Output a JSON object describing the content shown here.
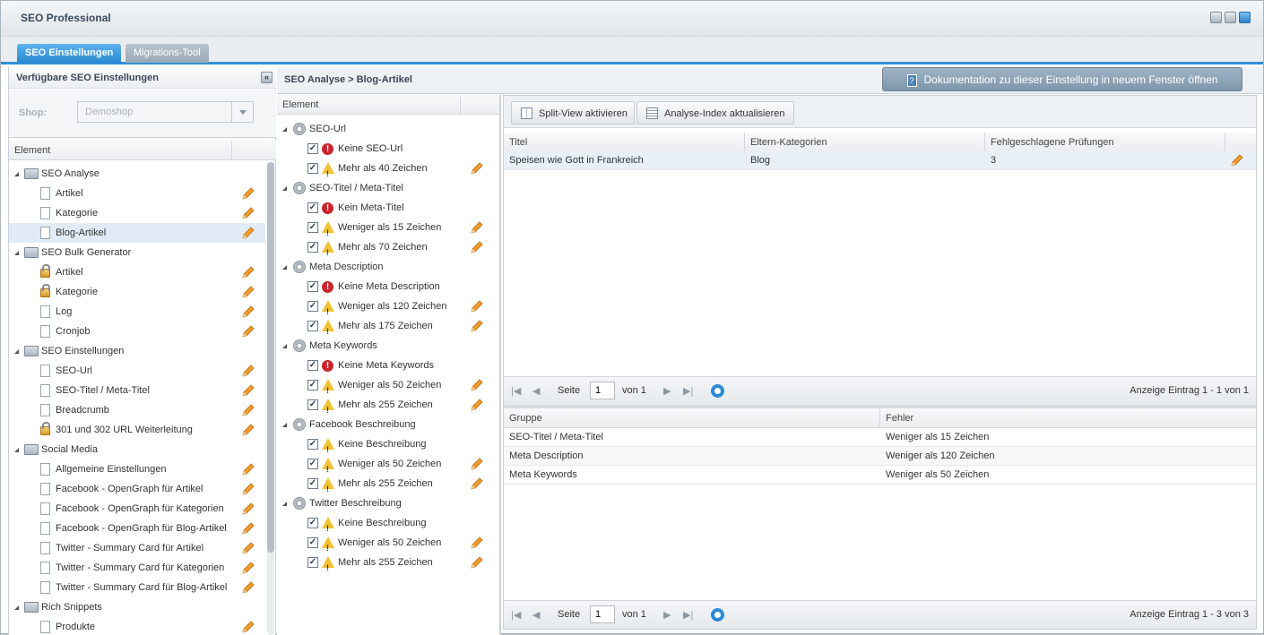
{
  "window": {
    "title": "SEO Professional"
  },
  "tabs": [
    {
      "label": "SEO Einstellungen",
      "active": true
    },
    {
      "label": "Migrations-Tool",
      "active": false
    }
  ],
  "left": {
    "title": "Verfügbare SEO Einstellungen",
    "shop_label": "Shop:",
    "shop_value": "Demoshop",
    "column": "Element",
    "tree": [
      {
        "label": "SEO Analyse",
        "type": "folder"
      },
      {
        "label": "Artikel",
        "type": "doc",
        "edit": true
      },
      {
        "label": "Kategorie",
        "type": "doc",
        "edit": true
      },
      {
        "label": "Blog-Artikel",
        "type": "doc",
        "edit": true,
        "selected": true
      },
      {
        "label": "SEO Bulk Generator",
        "type": "folder"
      },
      {
        "label": "Artikel",
        "type": "lock",
        "edit": true
      },
      {
        "label": "Kategorie",
        "type": "lock",
        "edit": true
      },
      {
        "label": "Log",
        "type": "doc",
        "edit": true
      },
      {
        "label": "Cronjob",
        "type": "doc",
        "edit": true
      },
      {
        "label": "SEO Einstellungen",
        "type": "folder"
      },
      {
        "label": "SEO-Url",
        "type": "doc",
        "edit": true
      },
      {
        "label": "SEO-Titel / Meta-Titel",
        "type": "doc",
        "edit": true
      },
      {
        "label": "Breadcrumb",
        "type": "doc",
        "edit": true
      },
      {
        "label": "301 und 302 URL Weiterleitung",
        "type": "lock",
        "edit": true
      },
      {
        "label": "Social Media",
        "type": "folder"
      },
      {
        "label": "Allgemeine Einstellungen",
        "type": "doc",
        "edit": true
      },
      {
        "label": "Facebook - OpenGraph für Artikel",
        "type": "doc",
        "edit": true
      },
      {
        "label": "Facebook - OpenGraph für Kategorien",
        "type": "doc",
        "edit": true
      },
      {
        "label": "Facebook - OpenGraph für Blog-Artikel",
        "type": "doc",
        "edit": true
      },
      {
        "label": "Twitter - Summary Card für Artikel",
        "type": "doc",
        "edit": true
      },
      {
        "label": "Twitter - Summary Card für Kategorien",
        "type": "doc",
        "edit": true
      },
      {
        "label": "Twitter - Summary Card für Blog-Artikel",
        "type": "doc",
        "edit": true
      },
      {
        "label": "Rich Snippets",
        "type": "folder"
      },
      {
        "label": "Produkte",
        "type": "doc",
        "edit": true
      }
    ]
  },
  "middle": {
    "title": "SEO Analyse > Blog-Artikel",
    "column": "Element",
    "tree": [
      {
        "label": "SEO-Url",
        "type": "group"
      },
      {
        "label": "Keine SEO-Url",
        "type": "err",
        "edit": false
      },
      {
        "label": "Mehr als 40 Zeichen",
        "type": "warn",
        "edit": true
      },
      {
        "label": "SEO-Titel / Meta-Titel",
        "type": "group"
      },
      {
        "label": "Kein Meta-Titel",
        "type": "err",
        "edit": false
      },
      {
        "label": "Weniger als 15 Zeichen",
        "type": "warn",
        "edit": true
      },
      {
        "label": "Mehr als 70 Zeichen",
        "type": "warn",
        "edit": true
      },
      {
        "label": "Meta Description",
        "type": "group"
      },
      {
        "label": "Keine Meta Description",
        "type": "err",
        "edit": false
      },
      {
        "label": "Weniger als 120 Zeichen",
        "type": "warn",
        "edit": true
      },
      {
        "label": "Mehr als 175 Zeichen",
        "type": "warn",
        "edit": true
      },
      {
        "label": "Meta Keywords",
        "type": "group"
      },
      {
        "label": "Keine Meta Keywords",
        "type": "err",
        "edit": false
      },
      {
        "label": "Weniger als 50 Zeichen",
        "type": "warn",
        "edit": true
      },
      {
        "label": "Mehr als 255 Zeichen",
        "type": "warn",
        "edit": true
      },
      {
        "label": "Facebook Beschreibung",
        "type": "group"
      },
      {
        "label": "Keine Beschreibung",
        "type": "warn",
        "edit": false
      },
      {
        "label": "Weniger als 50 Zeichen",
        "type": "warn",
        "edit": true
      },
      {
        "label": "Mehr als 255 Zeichen",
        "type": "warn",
        "edit": true
      },
      {
        "label": "Twitter Beschreibung",
        "type": "group"
      },
      {
        "label": "Keine Beschreibung",
        "type": "warn",
        "edit": false
      },
      {
        "label": "Weniger als 50 Zeichen",
        "type": "warn",
        "edit": true
      },
      {
        "label": "Mehr als 255 Zeichen",
        "type": "warn",
        "edit": true
      }
    ]
  },
  "right": {
    "doc_button": "Dokumentation zu dieser Einstellung in neuem Fenster öffnen",
    "toolbar": {
      "split_view": "Split-View aktivieren",
      "refresh_index": "Analyse-Index aktualisieren"
    },
    "grid1": {
      "columns": [
        "Titel",
        "Eltern-Kategorien",
        "Fehlgeschlagene Prüfungen"
      ],
      "rows": [
        [
          "Speisen wie Gott in Frankreich",
          "Blog",
          "3"
        ]
      ]
    },
    "pager1": {
      "page_label": "Seite",
      "page": "1",
      "of": "von 1",
      "info": "Anzeige Eintrag 1 - 1 von 1"
    },
    "grid2": {
      "columns": [
        "Gruppe",
        "Fehler"
      ],
      "rows": [
        [
          "SEO-Titel / Meta-Titel",
          "Weniger als 15 Zeichen"
        ],
        [
          "Meta Description",
          "Weniger als 120 Zeichen"
        ],
        [
          "Meta Keywords",
          "Weniger als 50 Zeichen"
        ]
      ]
    },
    "pager2": {
      "page_label": "Seite",
      "page": "1",
      "of": "von 1",
      "info": "Anzeige Eintrag 1 - 3 von 3"
    }
  }
}
